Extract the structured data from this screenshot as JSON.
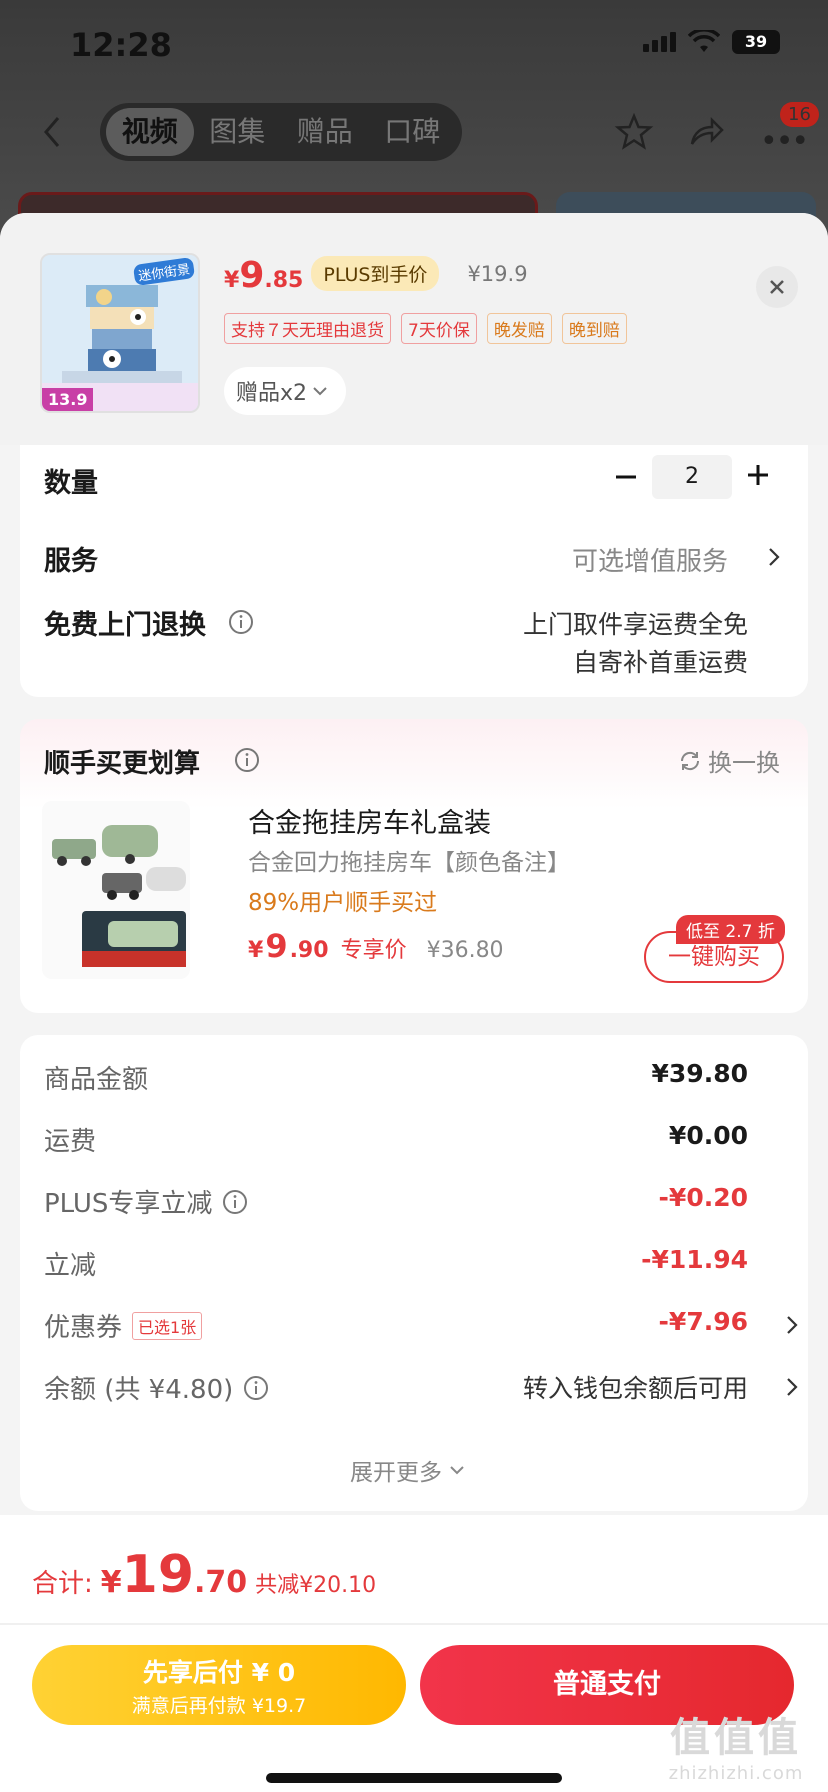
{
  "status": {
    "time": "12:28",
    "battery": "39"
  },
  "nav": {
    "tabs": [
      {
        "label": "视频",
        "active": true
      },
      {
        "label": "图集",
        "active": false
      },
      {
        "label": "赠品",
        "active": false
      },
      {
        "label": "口碑",
        "active": false
      }
    ],
    "badge": "16"
  },
  "product": {
    "thumb_title": "迷你街景",
    "thumb_price": "13.9",
    "price_yen": "¥",
    "price_int": "9",
    "price_dec": ".85",
    "plus_label": "PLUS到手价",
    "orig_price": "¥19.9",
    "tags": [
      {
        "text": "支持７天无理由退货",
        "style": "red"
      },
      {
        "text": "7天价保",
        "style": "red"
      },
      {
        "text": "晚发赔",
        "style": "orange"
      },
      {
        "text": "晚到赔",
        "style": "orange"
      }
    ],
    "gift": "赠品x2"
  },
  "options": {
    "quantity_label": "数量",
    "quantity": "2",
    "service_label": "服务",
    "service_value": "可选增值服务",
    "free_return_label": "免费上门退换",
    "free_return_line1": "上门取件享运费全免",
    "free_return_line2": "自寄补首重运费"
  },
  "addon": {
    "title": "顺手买更划算",
    "swap": "换一换",
    "name": "合金拖挂房车礼盒装",
    "sub": "合金回力拖挂房车【颜色备注】",
    "bought": "89%用户顺手买过",
    "price_yen": "¥",
    "price_int": "9",
    "price_dec": ".90",
    "price_label": "专享价",
    "orig_price": "¥36.80",
    "discount": "低至 2.7 折",
    "buy": "一键购买"
  },
  "summary": {
    "rows": [
      {
        "label": "商品金额",
        "value": "¥39.80"
      },
      {
        "label": "运费",
        "value": "¥0.00"
      },
      {
        "label": "PLUS专享立减",
        "value": "-¥0.20"
      },
      {
        "label": "立减",
        "value": "-¥11.94"
      },
      {
        "label": "优惠券",
        "tag": "已选1张",
        "value": "-¥7.96"
      },
      {
        "label": "余额 (共 ¥4.80)",
        "value": "转入钱包余额后可用"
      }
    ],
    "expand": "展开更多"
  },
  "footer": {
    "total_label": "合计:",
    "total_yen": "¥",
    "total_int": "19",
    "total_dec": ".70",
    "total_save": "共减¥20.10",
    "later_line1": "先享后付 ¥ 0",
    "later_line2": "满意后再付款 ¥19.7",
    "pay": "普通支付"
  },
  "watermark": {
    "big": "值值值",
    "small": "zhizhizhi.com"
  },
  "colors": {
    "accent": "#e4393c",
    "orange": "#d97a1c",
    "yellow": "#ffc51e"
  }
}
